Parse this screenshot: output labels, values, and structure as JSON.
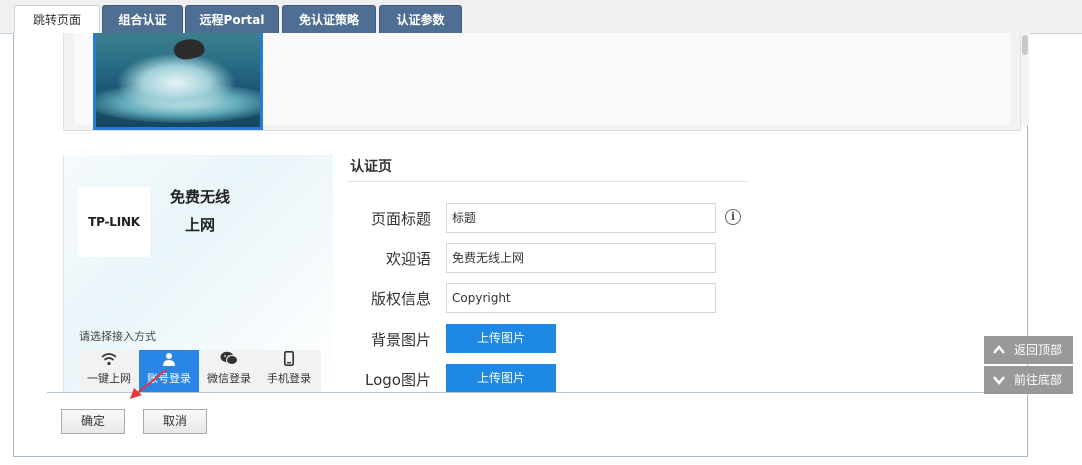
{
  "tabs": [
    {
      "label": "跳转页面",
      "active": true
    },
    {
      "label": "组合认证",
      "active": false
    },
    {
      "label": "远程Portal",
      "active": false
    },
    {
      "label": "免认证策略",
      "active": false
    },
    {
      "label": "认证参数",
      "active": false
    }
  ],
  "phone_preview": {
    "logo_text": "TP-LINK",
    "title_line1": "免费无线",
    "title_line2": "上网",
    "choose_label": "请选择接入方式",
    "methods": [
      {
        "label": "一键上网",
        "icon": "wifi-icon",
        "active": false
      },
      {
        "label": "账号登录",
        "icon": "user-icon",
        "active": true
      },
      {
        "label": "微信登录",
        "icon": "wechat-icon",
        "active": false
      },
      {
        "label": "手机登录",
        "icon": "phone-icon",
        "active": false
      }
    ]
  },
  "form": {
    "section_title": "认证页",
    "page_title_label": "页面标题",
    "page_title_value": "标题",
    "welcome_label": "欢迎语",
    "welcome_value": "免费无线上网",
    "copyright_label": "版权信息",
    "copyright_value": "Copyright",
    "bg_image_label": "背景图片",
    "logo_image_label": "Logo图片",
    "upload_label": "上传图片"
  },
  "footer": {
    "confirm_label": "确定",
    "cancel_label": "取消"
  },
  "float_nav": {
    "top_label": "返回顶部",
    "bottom_label": "前往底部"
  },
  "colors": {
    "tab_bg": "#4e6f93",
    "accent_blue": "#1e88e5",
    "float_gray": "#999999",
    "arrow_red": "#e53935"
  }
}
